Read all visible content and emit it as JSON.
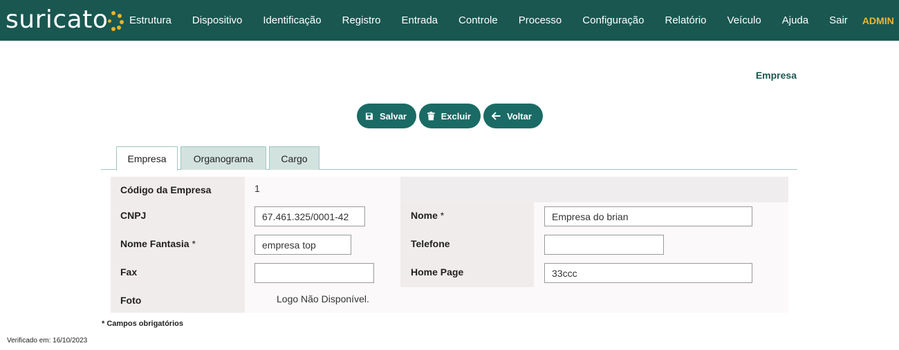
{
  "header": {
    "logo_text": "suricato",
    "menu": [
      "Estrutura",
      "Dispositivo",
      "Identificação",
      "Registro",
      "Entrada",
      "Controle",
      "Processo",
      "Configuração",
      "Relatório",
      "Veículo",
      "Ajuda",
      "Sair"
    ],
    "user": "ADMIN"
  },
  "page": {
    "title": "Empresa"
  },
  "actions": {
    "save": "Salvar",
    "delete": "Excluir",
    "back": "Voltar"
  },
  "tabs": [
    {
      "label": "Empresa",
      "active": true
    },
    {
      "label": "Organograma",
      "active": false
    },
    {
      "label": "Cargo",
      "active": false
    }
  ],
  "form": {
    "codigo": {
      "label": "Código da Empresa",
      "value": "1"
    },
    "cnpj": {
      "label": "CNPJ",
      "value": "67.461.325/0001-42"
    },
    "nome": {
      "label": "Nome",
      "required_mark": "*",
      "value": "Empresa do brian"
    },
    "nome_fantasia": {
      "label": "Nome Fantasia",
      "required_mark": "*",
      "value": "empresa top"
    },
    "telefone": {
      "label": "Telefone",
      "value": ""
    },
    "fax": {
      "label": "Fax",
      "value": ""
    },
    "home_page": {
      "label": "Home Page",
      "value": "33ccc"
    },
    "foto": {
      "label": "Foto",
      "value": "Logo Não Disponível."
    }
  },
  "required_note": "* Campos obrigatórios",
  "footer": "Verificado em: 16/10/2023",
  "colors": {
    "primary": "#1a5751",
    "button": "#1a6b65",
    "accent": "#f2b52c",
    "tab_inactive": "#d2e2df"
  }
}
